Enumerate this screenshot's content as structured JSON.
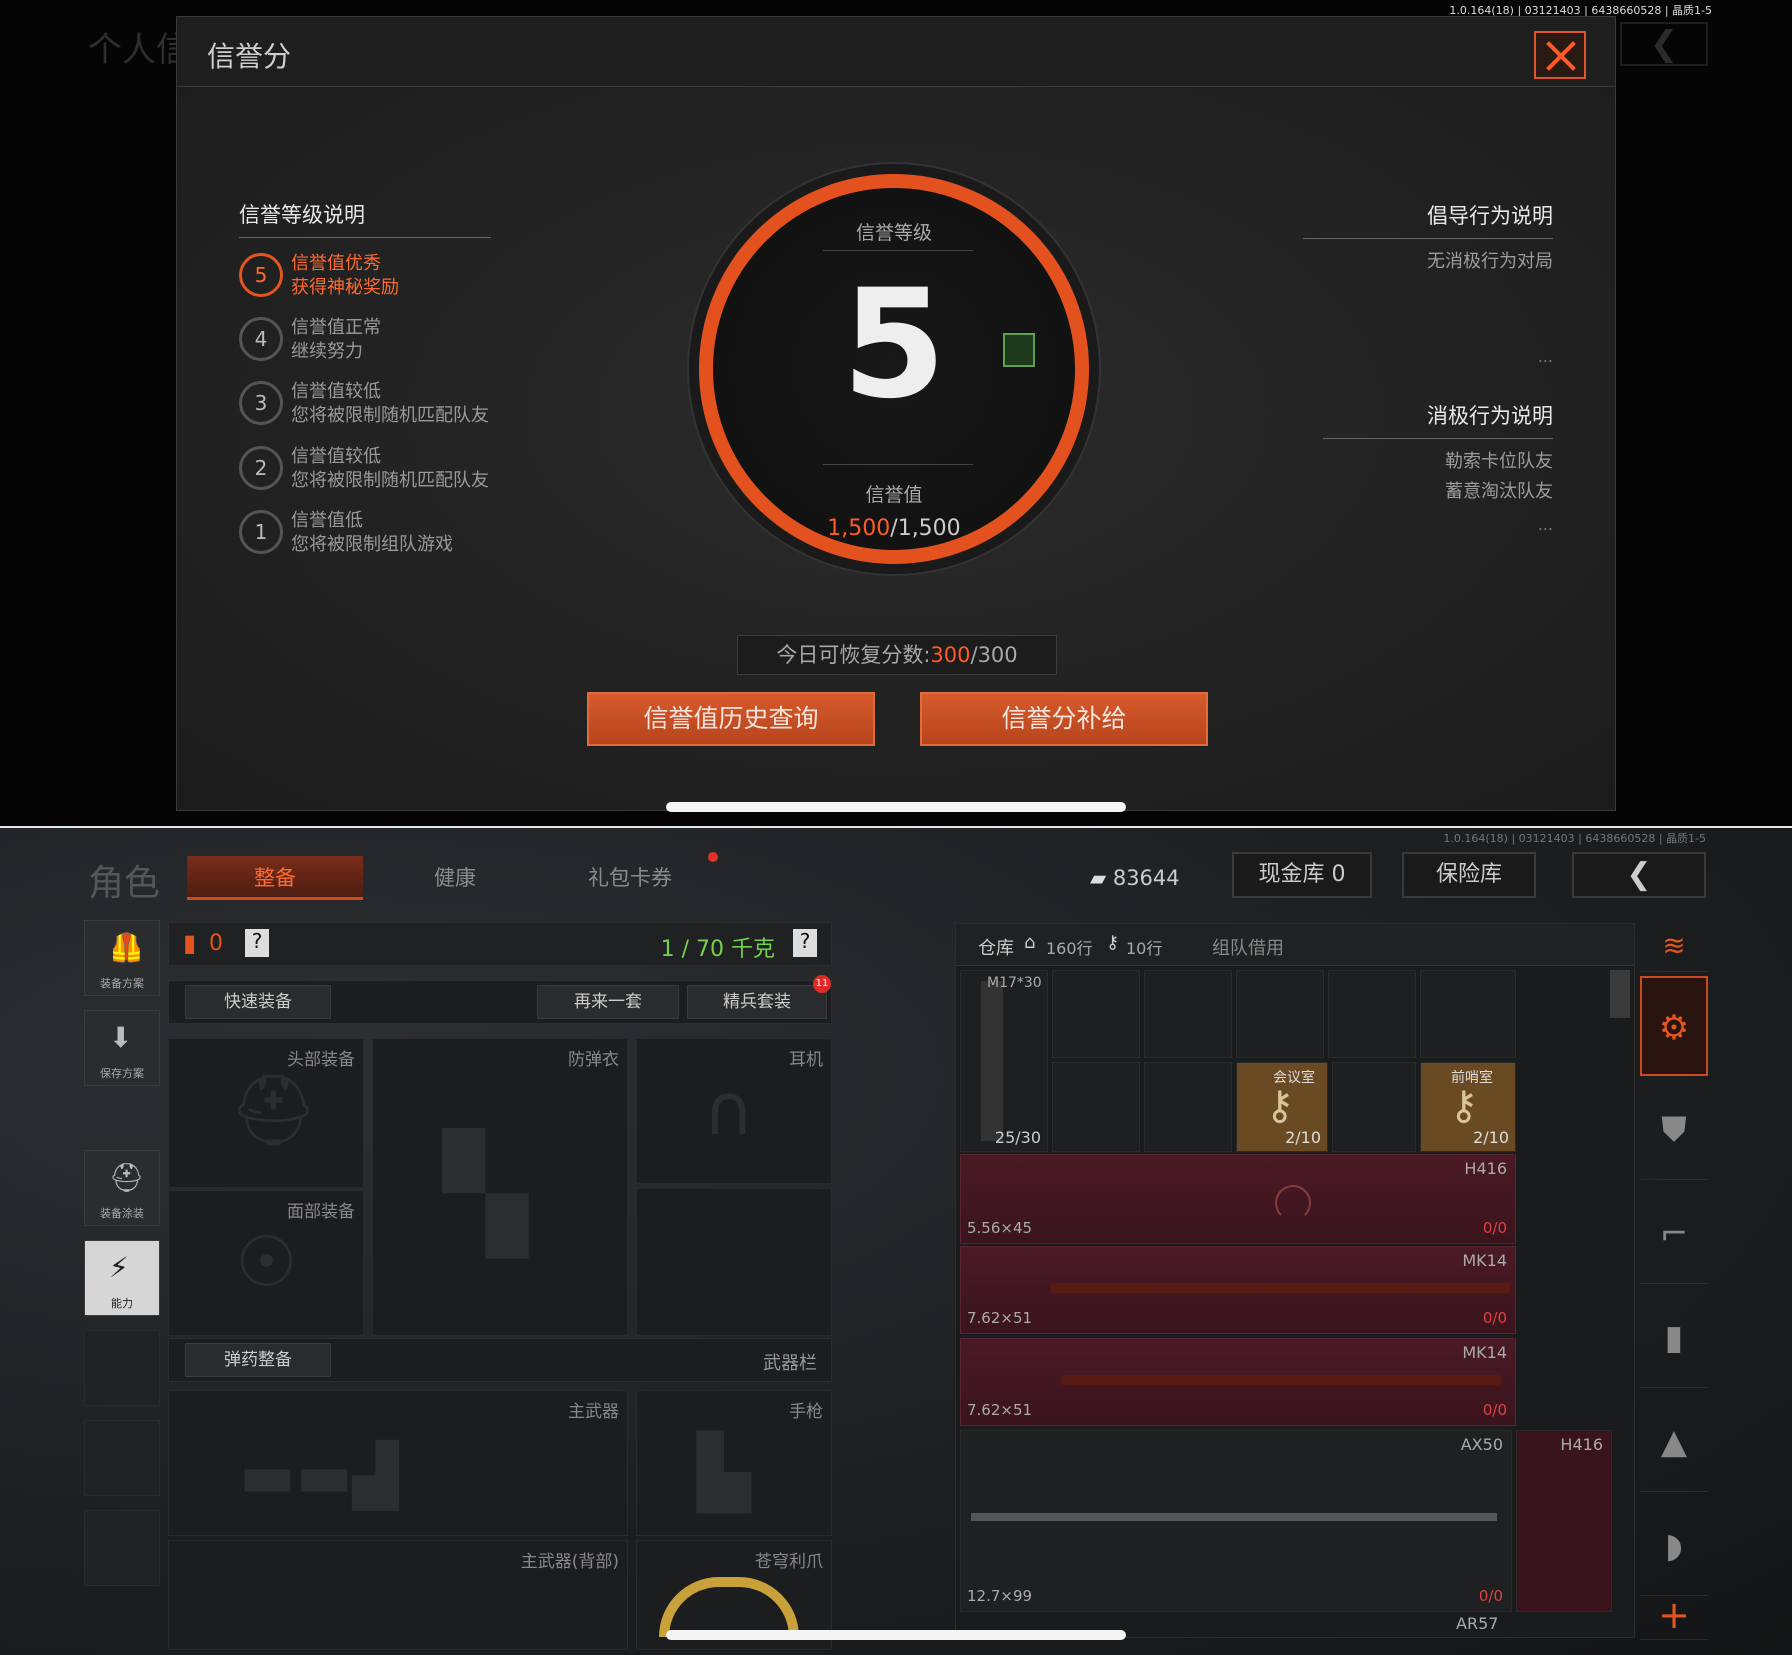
{
  "top": {
    "version": "1.0.164(18) | 03121403 | 6438660528 | 晶质1-5",
    "bg_title": "个人信",
    "modal": {
      "title": "信誉分",
      "left_heading": "信誉等级说明",
      "levels": [
        {
          "num": "5",
          "line1": "信誉值优秀",
          "line2": "获得神秘奖励"
        },
        {
          "num": "4",
          "line1": "信誉值正常",
          "line2": "继续努力"
        },
        {
          "num": "3",
          "line1": "信誉值较低",
          "line2": "您将被限制随机匹配队友"
        },
        {
          "num": "2",
          "line1": "信誉值较低",
          "line2": "您将被限制随机匹配队友"
        },
        {
          "num": "1",
          "line1": "信誉值低",
          "line2": "您将被限制组队游戏"
        }
      ],
      "ring": {
        "level_label": "信誉等级",
        "level": "5",
        "value_label": "信誉值",
        "current": "1,500",
        "max": "/1,500"
      },
      "right": {
        "advocate_heading": "倡导行为说明",
        "advocate_items": [
          "无消极行为对局"
        ],
        "negative_heading": "消极行为说明",
        "negative_items": [
          "勒索卡位队友",
          "蓄意淘汰队友"
        ],
        "more": "..."
      },
      "recover": {
        "label": "今日可恢复分数:",
        "current": "300",
        "max": "/300"
      },
      "btn_history": "信誉值历史查询",
      "btn_supply": "信誉分补给"
    }
  },
  "bottom": {
    "version": "1.0.164(18) | 03121403 | 6438660528 | 晶质1-5",
    "nav": {
      "title": "角色",
      "tabs": [
        "整备",
        "健康",
        "礼包卡券"
      ],
      "money": "83644",
      "cash_store": "现金库 0",
      "vault": "保险库",
      "back": "❮"
    },
    "side": [
      {
        "icon": "🦺",
        "label": "装备方案"
      },
      {
        "icon": "⬇",
        "label": "保存方案"
      },
      {
        "icon": "⛑",
        "label": "装备涂装"
      },
      {
        "icon": "⚡",
        "label": "能力"
      }
    ],
    "loadout": {
      "count": "0",
      "help": "?",
      "weight": "1 / 70 千克",
      "quick_equip": "快速装备",
      "again": "再来一套",
      "elite": "精兵套装",
      "elite_badge": "11",
      "slots": {
        "head": "头部装备",
        "armor": "防弹衣",
        "ear": "耳机",
        "face": "面部装备"
      },
      "ammo_btn": "弹药整备",
      "weapon_bar": "武器栏",
      "primary": "主武器",
      "pistol": "手枪",
      "primary_back": "主武器(背部)",
      "melee": "苍穹利爪"
    },
    "inventory": {
      "tab_store": "仓库",
      "home_cap": "160行",
      "key_cap": "10行",
      "team_borrow": "组队借用",
      "mag": {
        "name": "M17*30",
        "count": "25/30"
      },
      "keys": [
        {
          "name": "会议室",
          "count": "2/10"
        },
        {
          "name": "前哨室",
          "count": "2/10"
        }
      ],
      "guns": [
        {
          "name": "H416",
          "cal": "5.56×45",
          "ammo": "0/0"
        },
        {
          "name": "MK14",
          "cal": "7.62×51",
          "ammo": "0/0"
        },
        {
          "name": "MK14",
          "cal": "7.62×51",
          "ammo": "0/0"
        }
      ],
      "sniper": {
        "name": "AX50",
        "cal": "12.7×99",
        "ammo": "0/0"
      },
      "side_gun": "H416",
      "next": "AR57"
    }
  }
}
